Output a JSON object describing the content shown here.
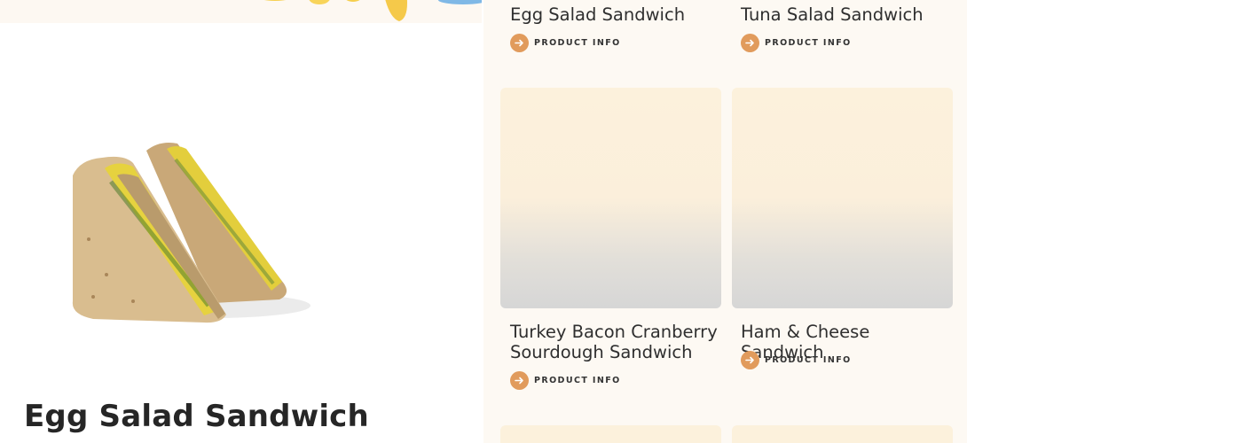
{
  "detail": {
    "title": "Egg Salad Sandwich"
  },
  "grid": {
    "cards": [
      {
        "title": "Egg Salad Sandwich",
        "link_label": "PRODUCT INFO"
      },
      {
        "title": "Tuna Salad Sandwich",
        "link_label": "PRODUCT INFO"
      },
      {
        "title": "Turkey Bacon Cranberry Sourdough Sandwich",
        "link_label": "PRODUCT INFO"
      },
      {
        "title": "Ham & Cheese Sandwich",
        "link_label": "PRODUCT INFO"
      }
    ]
  },
  "colors": {
    "accent": "#e19b5c",
    "card_background": "#fcf1dc",
    "grid_background": "#fdf9f3"
  },
  "icons": {
    "link_icon": "arrow-right-icon"
  }
}
